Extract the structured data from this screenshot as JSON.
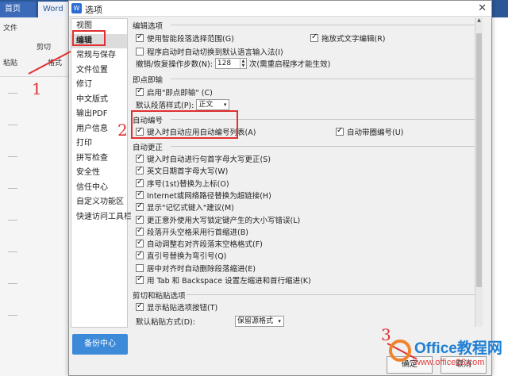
{
  "app": {
    "tabs": [
      "首页",
      "Word"
    ],
    "toolbar": [
      "文件",
      "剪切",
      "粘贴",
      "格式"
    ]
  },
  "dialog": {
    "title": "选项",
    "close_icon": "✕",
    "sidebar": [
      "视图",
      "编辑",
      "常规与保存",
      "文件位置",
      "修订",
      "中文版式",
      "输出PDF",
      "用户信息",
      "打印",
      "拼写检查",
      "安全性",
      "信任中心",
      "自定义功能区",
      "快速访问工具栏"
    ],
    "backup_label": "备份中心",
    "sections": {
      "edit_options": {
        "title": "编辑选项",
        "drag_select": "使用智能段落选择范围(G)",
        "drag_text": "拖放式文字编辑(R)",
        "ime_switch": "程序启动时自动切换到默认语言输入法(I)",
        "undo_label": "撤销/恢复操作步数(N):",
        "undo_value": "128",
        "undo_note": "次(需重启程序才能生效)"
      },
      "click_type": {
        "title": "即点即输",
        "enable": "启用\"即点即输\" (C)",
        "default_style_label": "默认段落样式(P):",
        "default_style_value": "正文"
      },
      "auto_number": {
        "title": "自动编号",
        "apply_list": "键入时自动应用自动编号列表(A)",
        "auto_bullets": "自动带圈编号(U)"
      },
      "auto_correct": {
        "title": "自动更正",
        "items": [
          "键入时自动进行句首字母大写更正(S)",
          "英文日期首字母大写(W)",
          "序号(1st)替换为上标(O)",
          "Internet或网络路径替换为超链接(H)",
          "显示\"记忆式键入\"建议(M)",
          "更正意外使用大写锁定键产生的大小写错误(L)",
          "段落开头空格采用行首缩进(B)",
          "自动调整右对齐段落末空格格式(F)",
          "直引号替换为弯引号(Q)",
          "居中对齐时自动删除段落缩进(E)",
          "用 Tab 和 Backspace 设置左缩进和首行缩进(K)"
        ],
        "checked": [
          true,
          true,
          true,
          true,
          true,
          true,
          true,
          true,
          true,
          false,
          true
        ]
      },
      "paste": {
        "title": "剪切和粘贴选项",
        "show_button": "显示粘贴选项按钮(T)",
        "default_paste_label": "默认粘贴方式(D):",
        "default_paste_value": "保留源格式"
      }
    },
    "ok_label": "确定",
    "cancel_label": "取消"
  },
  "annotations": [
    "1",
    "2",
    "3"
  ],
  "watermark": {
    "name": "Office教程网",
    "url": "www.office26.com"
  },
  "colors": {
    "accent_red": "#e03030",
    "backup_blue": "#3d8ad8",
    "tab_blue": "#2b5797"
  }
}
